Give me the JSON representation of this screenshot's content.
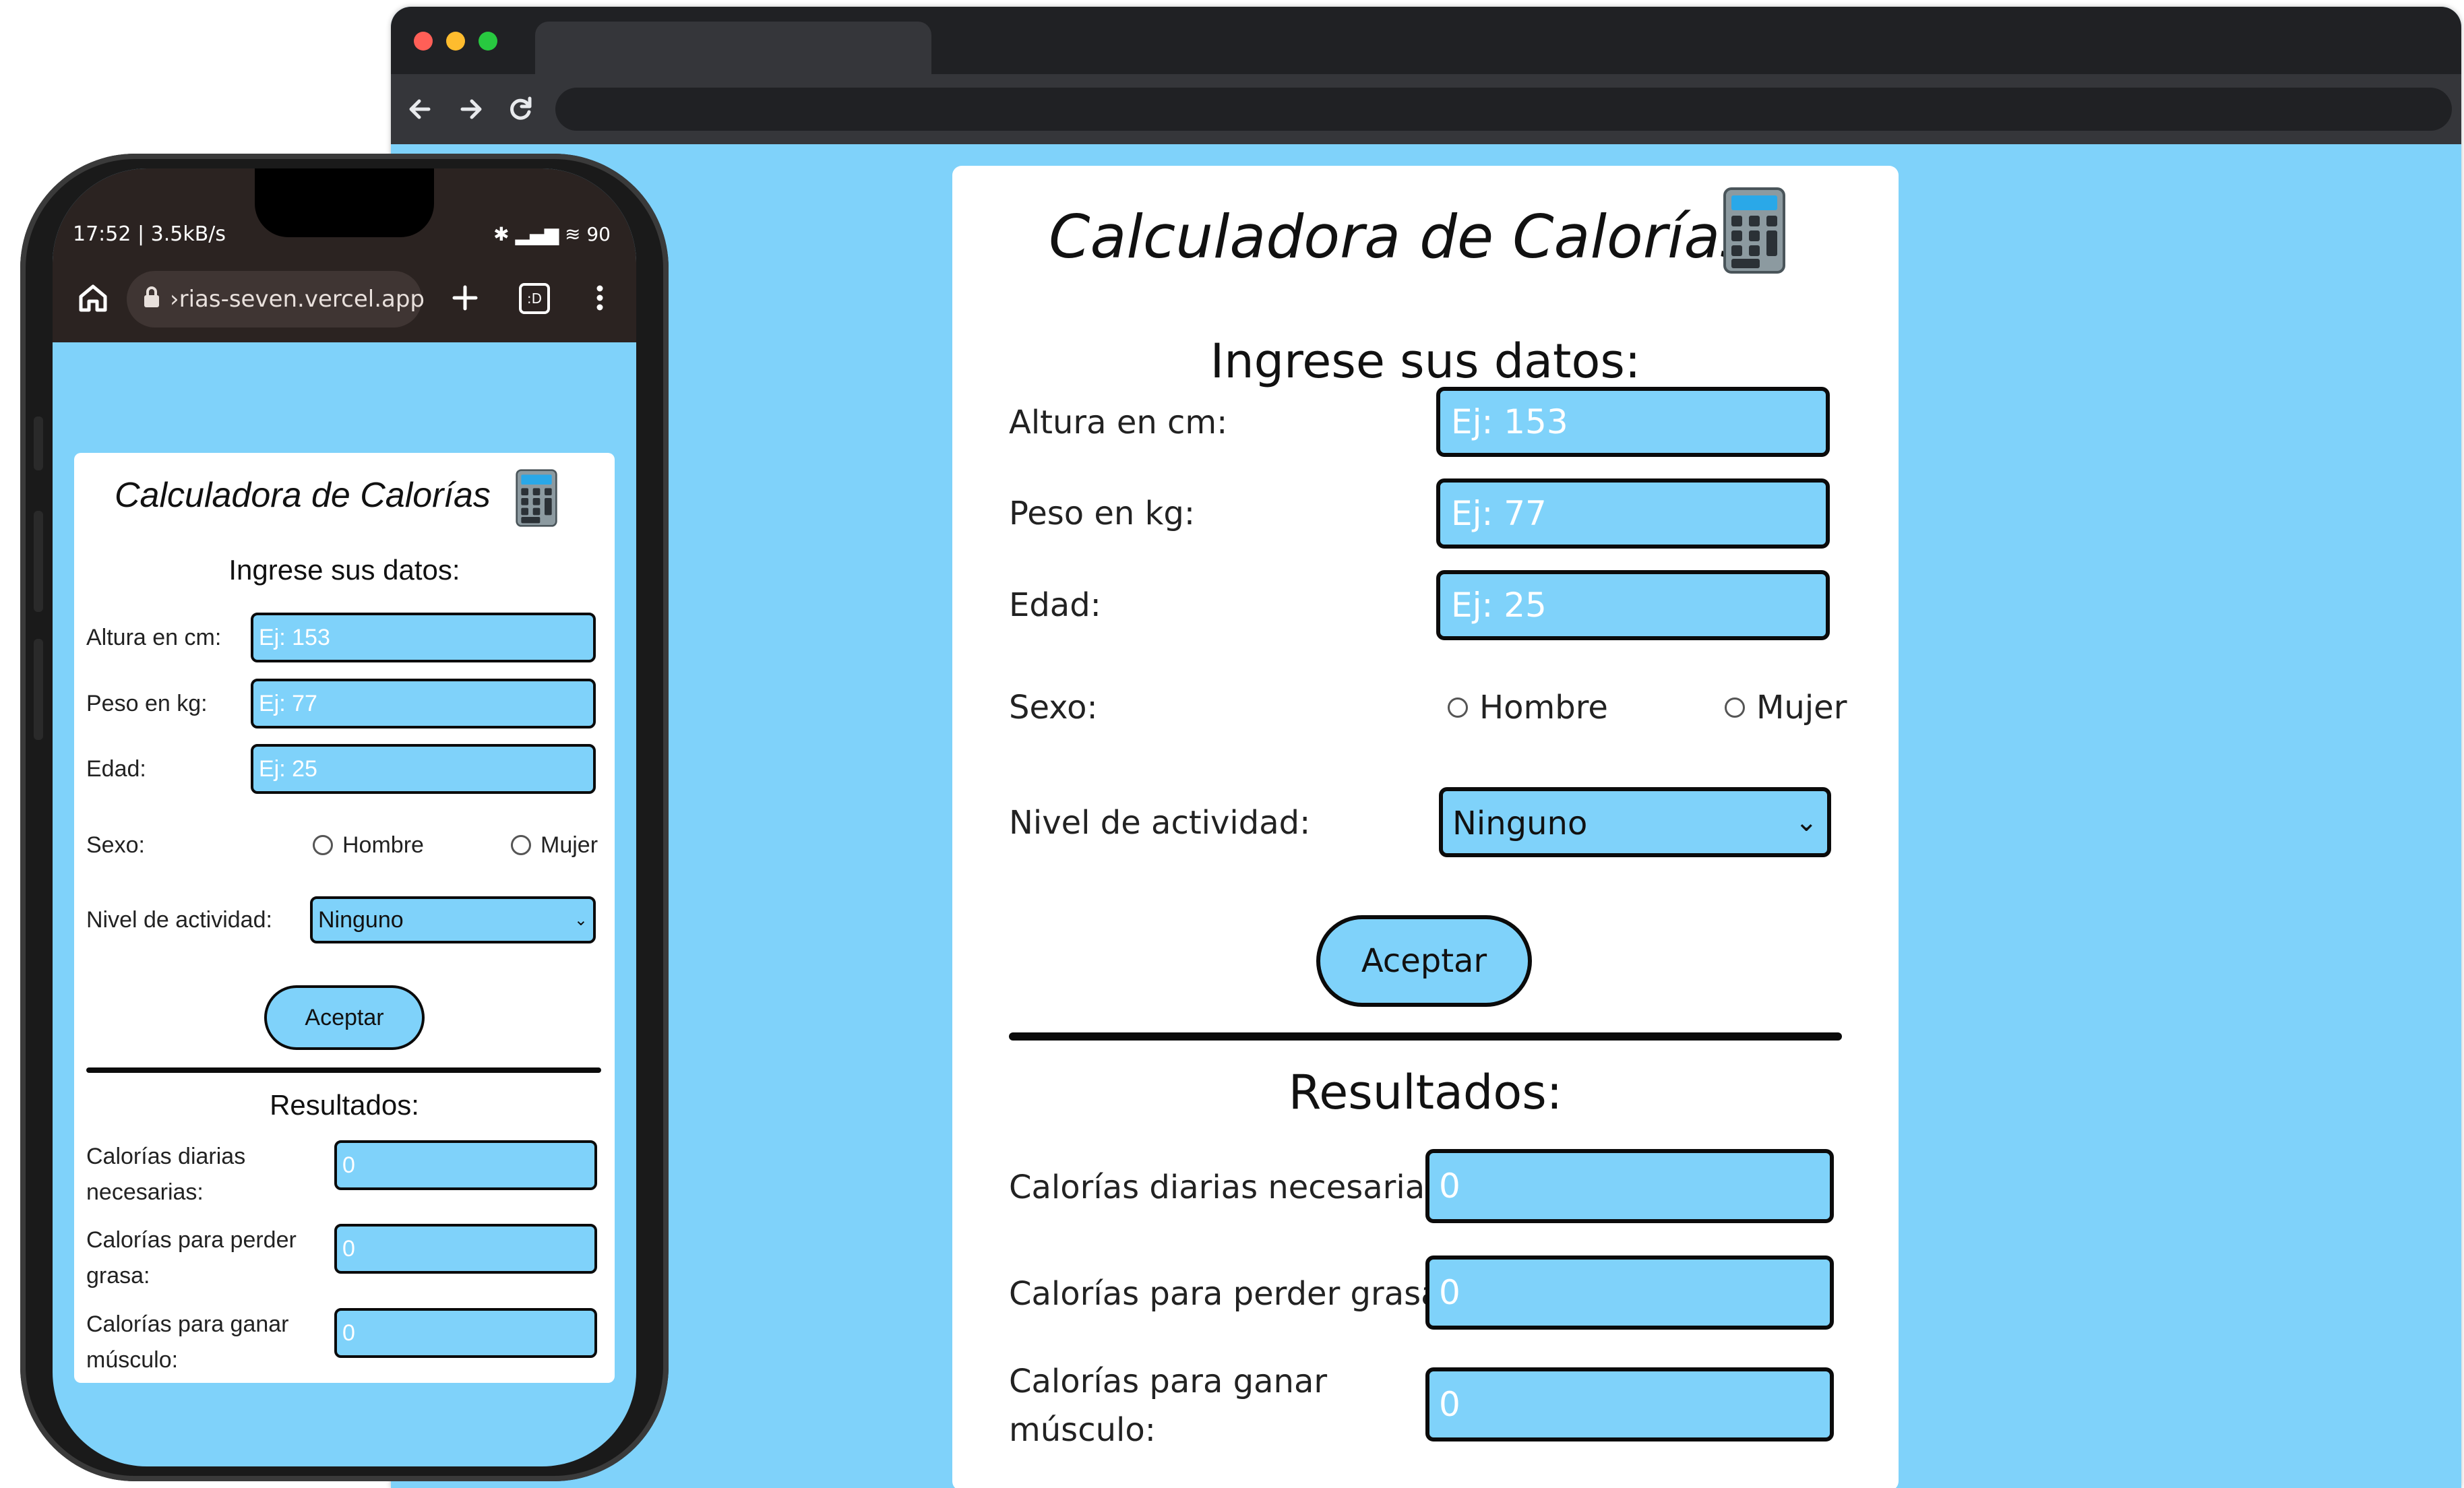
{
  "desktop": {
    "title": "Calculadora de Calorías",
    "subtitle": "Ingrese sus datos:",
    "fields": [
      {
        "label": "Altura en cm:",
        "placeholder": "Ej: 153"
      },
      {
        "label": "Peso en kg:",
        "placeholder": "Ej: 77"
      },
      {
        "label": "Edad:",
        "placeholder": "Ej: 25"
      }
    ],
    "sexo_label": "Sexo:",
    "sexo_options": [
      "Hombre",
      "Mujer"
    ],
    "actividad_label": "Nivel de actividad:",
    "actividad_value": "Ninguno",
    "accept_label": "Aceptar",
    "results_title": "Resultados:",
    "results": [
      {
        "label": "Calorías diarias necesarias:",
        "placeholder": "0"
      },
      {
        "label": "Calorías para perder grasa:",
        "placeholder": "0"
      },
      {
        "label": "Calorías para ganar músculo:",
        "placeholder": "0"
      }
    ]
  },
  "phone": {
    "status_left": "17:52 | 3.5kB/s",
    "status_right": "✱ ▂▄▆ ≋ 90",
    "url": "›rias-seven.vercel.app",
    "tabs_count": ":D",
    "title": "Calculadora de Calorías",
    "subtitle": "Ingrese sus datos:",
    "fields": [
      {
        "label": "Altura en cm:",
        "placeholder": "Ej: 153"
      },
      {
        "label": "Peso en kg:",
        "placeholder": "Ej: 77"
      },
      {
        "label": "Edad:",
        "placeholder": "Ej: 25"
      }
    ],
    "sexo_label": "Sexo:",
    "sexo_options": [
      "Hombre",
      "Mujer"
    ],
    "actividad_label": "Nivel de actividad:",
    "actividad_value": "Ninguno",
    "accept_label": "Aceptar",
    "results_title": "Resultados:",
    "results": [
      {
        "label": "Calorías diarias necesarias:",
        "placeholder": "0"
      },
      {
        "label": "Calorías para perder grasa:",
        "placeholder": "0"
      },
      {
        "label": "Calorías para ganar músculo:",
        "placeholder": "0"
      }
    ]
  },
  "colors": {
    "background": "#7fd2fa",
    "input_fill": "#7fd2fa",
    "border": "#0b0b0b",
    "browser_chrome": "#202124",
    "phone_chrome": "#2b2321"
  },
  "icons": [
    "calculator-icon",
    "back-arrow-icon",
    "forward-arrow-icon",
    "reload-icon",
    "home-icon",
    "lock-icon",
    "plus-icon",
    "tabs-icon",
    "kebab-menu-icon"
  ]
}
